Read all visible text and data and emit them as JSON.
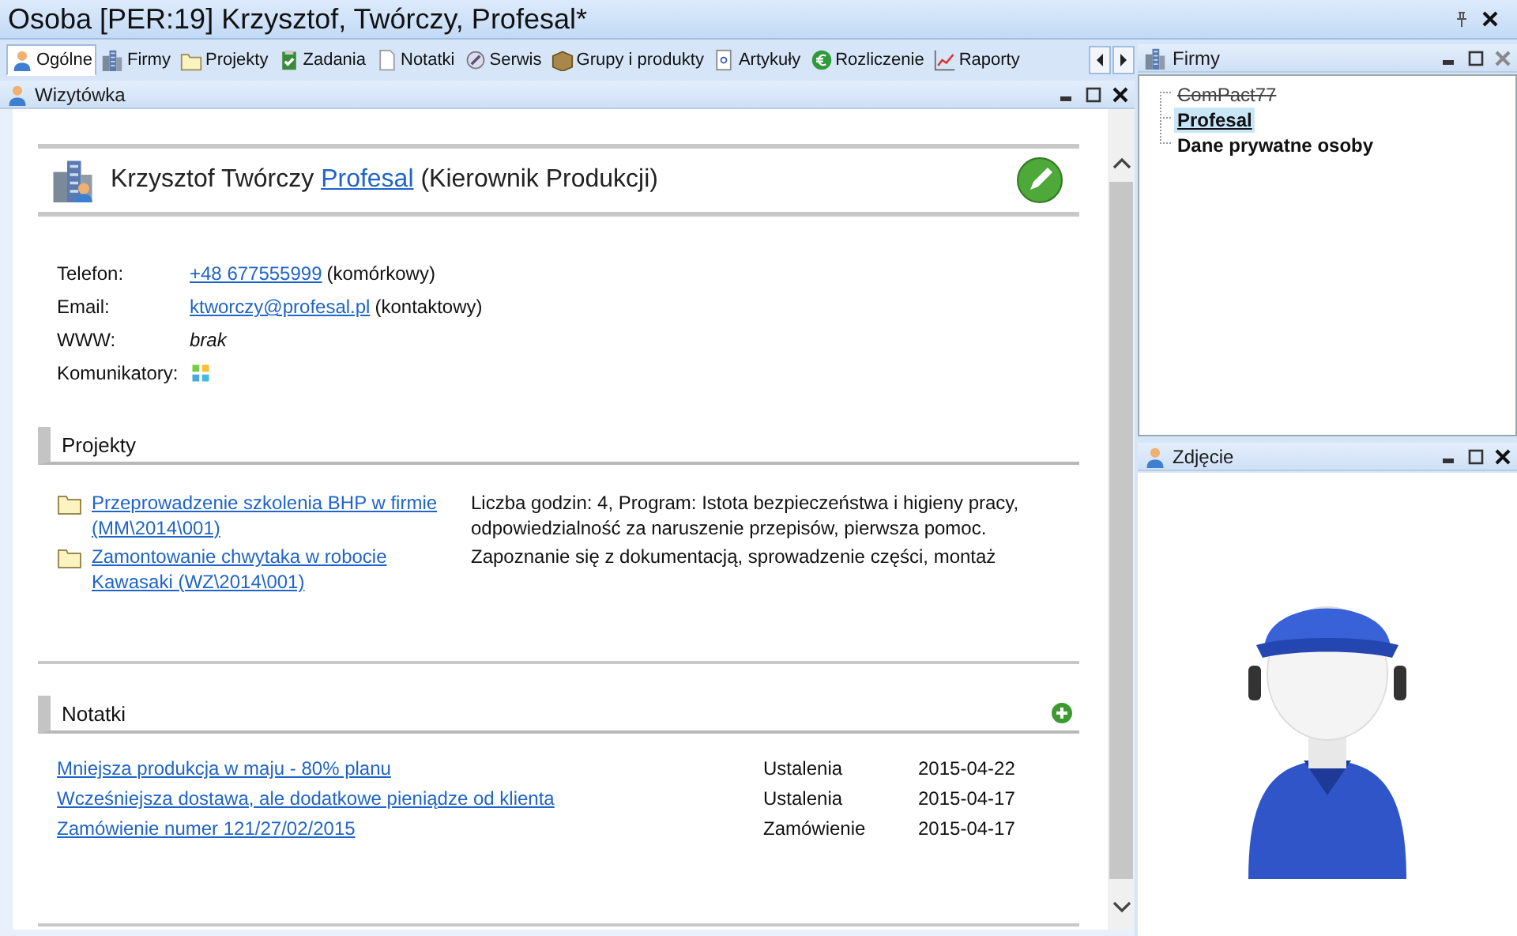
{
  "window": {
    "title": "Osoba [PER:19] Krzysztof, Twórczy, Profesal*"
  },
  "tabs": [
    {
      "label": "Ogólne",
      "selected": true
    },
    {
      "label": "Firmy",
      "selected": false
    },
    {
      "label": "Projekty",
      "selected": false
    },
    {
      "label": "Zadania",
      "selected": false
    },
    {
      "label": "Notatki",
      "selected": false
    },
    {
      "label": "Serwis",
      "selected": false
    },
    {
      "label": "Grupy i produkty",
      "selected": false
    },
    {
      "label": "Artykuły",
      "selected": false
    },
    {
      "label": "Rozliczenie",
      "selected": false
    },
    {
      "label": "Raporty",
      "selected": false
    }
  ],
  "main_panel": {
    "title": "Wizytówka"
  },
  "card": {
    "name": "Krzysztof Twórczy",
    "company": "Profesal",
    "role": "(Kierownik Produkcji)"
  },
  "contacts": [
    {
      "kind": "link",
      "label": "Telefon:",
      "value": "+48 677555999",
      "note": "(komórkowy)"
    },
    {
      "kind": "link",
      "label": "Email:",
      "value": "ktworczy@profesal.pl",
      "note": "(kontaktowy)"
    },
    {
      "kind": "empty",
      "label": "WWW:",
      "value": "brak"
    },
    {
      "kind": "icon",
      "label": "Komunikatory:"
    }
  ],
  "projects": {
    "title": "Projekty",
    "items": [
      {
        "name": "Przeprowadzenie szkolenia BHP w firmie (MM\\2014\\001)",
        "description": "Liczba godzin: 4, Program: Istota bezpieczeństwa i higieny pracy, odpowiedzialność za naruszenie przepisów, pierwsza pomoc."
      },
      {
        "name": "Zamontowanie chwytaka w robocie Kawasaki (WZ\\2014\\001)",
        "description": "Zapoznanie się z dokumentacją, sprowadzenie części, montaż"
      }
    ]
  },
  "notes": {
    "title": "Notatki",
    "items": [
      {
        "title": "Mniejsza produkcja w maju - 80% planu",
        "category": "Ustalenia",
        "date": "2015-04-22"
      },
      {
        "title": "Wcześniejsza dostawa, ale dodatkowe pieniądze od klienta",
        "category": "Ustalenia",
        "date": "2015-04-17"
      },
      {
        "title": "Zamówienie numer 121/27/02/2015",
        "category": "Zamówienie",
        "date": "2015-04-17"
      }
    ]
  },
  "firms_panel": {
    "title": "Firmy",
    "items": [
      {
        "label": "ComPact77",
        "inactive": true,
        "selected": false
      },
      {
        "label": "Profesal",
        "inactive": false,
        "selected": true
      },
      {
        "label": "Dane prywatne osoby",
        "inactive": false,
        "selected": false
      }
    ]
  },
  "photo_panel": {
    "title": "Zdjęcie"
  }
}
